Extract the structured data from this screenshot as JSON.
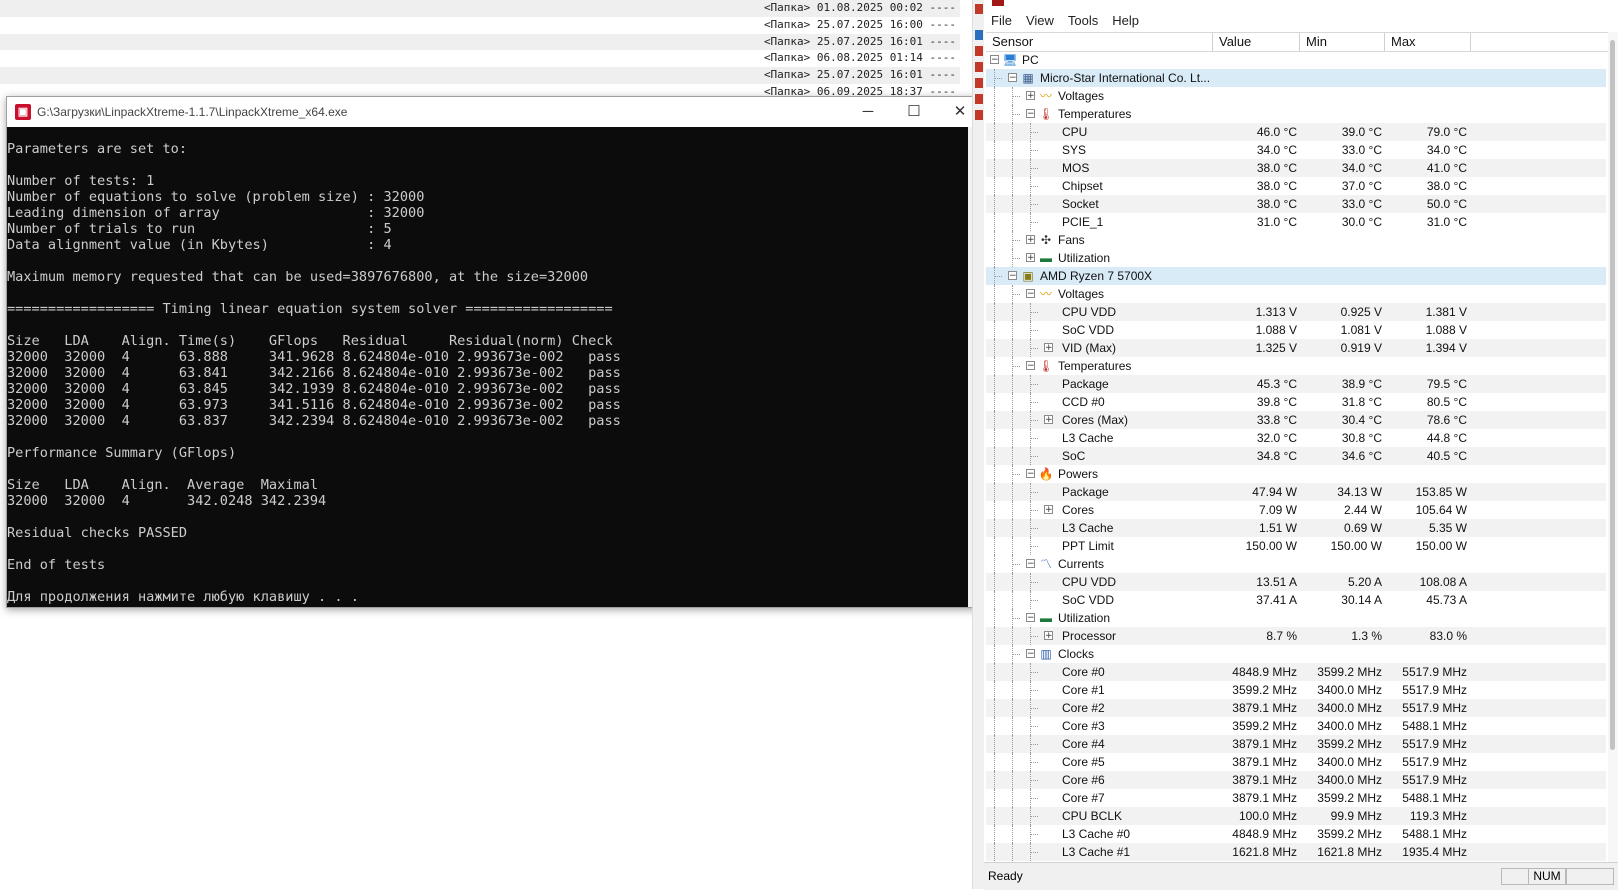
{
  "background_list": [
    {
      "text": "<Папка> 01.08.2025 00:02 ----"
    },
    {
      "text": "<Папка> 25.07.2025 16:00 ----"
    },
    {
      "text": "<Папка> 25.07.2025 16:01 ----"
    },
    {
      "text": "<Папка> 06.08.2025 01:14 ----"
    },
    {
      "text": "<Папка> 25.07.2025 16:01 ----"
    },
    {
      "text": "<Папка> 06.09.2025 18:37 ----"
    }
  ],
  "console": {
    "title": "G:\\Загрузки\\LinpackXtreme-1.1.7\\LinpackXtreme_x64.exe",
    "lines": [
      "Parameters are set to:",
      "",
      "Number of tests: 1",
      "Number of equations to solve (problem size) : 32000",
      "Leading dimension of array                  : 32000",
      "Number of trials to run                     : 5",
      "Data alignment value (in Kbytes)            : 4",
      "",
      "Maximum memory requested that can be used=3897676800, at the size=32000",
      "",
      "================== Timing linear equation system solver ==================",
      "",
      "Size   LDA    Align. Time(s)    GFlops   Residual     Residual(norm) Check",
      "32000  32000  4      63.888     341.9628 8.624804e-010 2.993673e-002   pass",
      "32000  32000  4      63.841     342.2166 8.624804e-010 2.993673e-002   pass",
      "32000  32000  4      63.845     342.1939 8.624804e-010 2.993673e-002   pass",
      "32000  32000  4      63.973     341.5116 8.624804e-010 2.993673e-002   pass",
      "32000  32000  4      63.837     342.2394 8.624804e-010 2.993673e-002   pass",
      "",
      "Performance Summary (GFlops)",
      "",
      "Size   LDA    Align.  Average  Maximal",
      "32000  32000  4       342.0248 342.2394",
      "",
      "Residual checks PASSED",
      "",
      "End of tests",
      "",
      "Для продолжения нажмите любую клавишу . . ."
    ]
  },
  "hwmonitor": {
    "menu": [
      "File",
      "View",
      "Tools",
      "Help"
    ],
    "columns": [
      "Sensor",
      "Value",
      "Min",
      "Max"
    ],
    "rows": [
      {
        "depth": 0,
        "exp": "-",
        "icon": "pc-icon",
        "label": "PC",
        "value": "",
        "min": "",
        "max": ""
      },
      {
        "depth": 1,
        "exp": "-",
        "icon": "motherboard-icon",
        "label": "Micro-Star International Co. Lt...",
        "value": "",
        "min": "",
        "max": "",
        "hl": true
      },
      {
        "depth": 2,
        "exp": "+",
        "icon": "voltage-icon",
        "label": "Voltages",
        "value": "",
        "min": "",
        "max": ""
      },
      {
        "depth": 2,
        "exp": "-",
        "icon": "thermometer-icon",
        "label": "Temperatures",
        "value": "",
        "min": "",
        "max": ""
      },
      {
        "depth": 3,
        "exp": "",
        "icon": "",
        "label": "CPU",
        "value": "46.0 °C",
        "min": "39.0 °C",
        "max": "79.0 °C"
      },
      {
        "depth": 3,
        "exp": "",
        "icon": "",
        "label": "SYS",
        "value": "34.0 °C",
        "min": "33.0 °C",
        "max": "34.0 °C"
      },
      {
        "depth": 3,
        "exp": "",
        "icon": "",
        "label": "MOS",
        "value": "38.0 °C",
        "min": "34.0 °C",
        "max": "41.0 °C"
      },
      {
        "depth": 3,
        "exp": "",
        "icon": "",
        "label": "Chipset",
        "value": "38.0 °C",
        "min": "37.0 °C",
        "max": "38.0 °C"
      },
      {
        "depth": 3,
        "exp": "",
        "icon": "",
        "label": "Socket",
        "value": "38.0 °C",
        "min": "33.0 °C",
        "max": "50.0 °C"
      },
      {
        "depth": 3,
        "exp": "",
        "icon": "",
        "label": "PCIE_1",
        "value": "31.0 °C",
        "min": "30.0 °C",
        "max": "31.0 °C"
      },
      {
        "depth": 2,
        "exp": "+",
        "icon": "fan-icon",
        "label": "Fans",
        "value": "",
        "min": "",
        "max": ""
      },
      {
        "depth": 2,
        "exp": "+",
        "icon": "utilization-icon",
        "label": "Utilization",
        "value": "",
        "min": "",
        "max": ""
      },
      {
        "depth": 1,
        "exp": "-",
        "icon": "cpu-chip-icon",
        "label": "AMD Ryzen 7 5700X",
        "value": "",
        "min": "",
        "max": "",
        "hl": true
      },
      {
        "depth": 2,
        "exp": "-",
        "icon": "voltage-icon",
        "label": "Voltages",
        "value": "",
        "min": "",
        "max": ""
      },
      {
        "depth": 3,
        "exp": "",
        "icon": "",
        "label": "CPU VDD",
        "value": "1.313 V",
        "min": "0.925 V",
        "max": "1.381 V"
      },
      {
        "depth": 3,
        "exp": "",
        "icon": "",
        "label": "SoC VDD",
        "value": "1.088 V",
        "min": "1.081 V",
        "max": "1.088 V"
      },
      {
        "depth": 3,
        "exp": "+",
        "icon": "",
        "label": "VID (Max)",
        "value": "1.325 V",
        "min": "0.919 V",
        "max": "1.394 V"
      },
      {
        "depth": 2,
        "exp": "-",
        "icon": "thermometer-icon",
        "label": "Temperatures",
        "value": "",
        "min": "",
        "max": ""
      },
      {
        "depth": 3,
        "exp": "",
        "icon": "",
        "label": "Package",
        "value": "45.3 °C",
        "min": "38.9 °C",
        "max": "79.5 °C"
      },
      {
        "depth": 3,
        "exp": "",
        "icon": "",
        "label": "CCD #0",
        "value": "39.8 °C",
        "min": "31.8 °C",
        "max": "80.5 °C"
      },
      {
        "depth": 3,
        "exp": "+",
        "icon": "",
        "label": "Cores (Max)",
        "value": "33.8 °C",
        "min": "30.4 °C",
        "max": "78.6 °C"
      },
      {
        "depth": 3,
        "exp": "",
        "icon": "",
        "label": "L3 Cache",
        "value": "32.0 °C",
        "min": "30.8 °C",
        "max": "44.8 °C"
      },
      {
        "depth": 3,
        "exp": "",
        "icon": "",
        "label": "SoC",
        "value": "34.8 °C",
        "min": "34.6 °C",
        "max": "40.5 °C"
      },
      {
        "depth": 2,
        "exp": "-",
        "icon": "power-icon",
        "label": "Powers",
        "value": "",
        "min": "",
        "max": ""
      },
      {
        "depth": 3,
        "exp": "",
        "icon": "",
        "label": "Package",
        "value": "47.94 W",
        "min": "34.13 W",
        "max": "153.85 W"
      },
      {
        "depth": 3,
        "exp": "+",
        "icon": "",
        "label": "Cores",
        "value": "7.09 W",
        "min": "2.44 W",
        "max": "105.64 W"
      },
      {
        "depth": 3,
        "exp": "",
        "icon": "",
        "label": "L3 Cache",
        "value": "1.51 W",
        "min": "0.69 W",
        "max": "5.35 W"
      },
      {
        "depth": 3,
        "exp": "",
        "icon": "",
        "label": "PPT Limit",
        "value": "150.00 W",
        "min": "150.00 W",
        "max": "150.00 W"
      },
      {
        "depth": 2,
        "exp": "-",
        "icon": "current-icon",
        "label": "Currents",
        "value": "",
        "min": "",
        "max": ""
      },
      {
        "depth": 3,
        "exp": "",
        "icon": "",
        "label": "CPU VDD",
        "value": "13.51 A",
        "min": "5.20 A",
        "max": "108.08 A"
      },
      {
        "depth": 3,
        "exp": "",
        "icon": "",
        "label": "SoC VDD",
        "value": "37.41 A",
        "min": "30.14 A",
        "max": "45.73 A"
      },
      {
        "depth": 2,
        "exp": "-",
        "icon": "utilization-icon",
        "label": "Utilization",
        "value": "",
        "min": "",
        "max": ""
      },
      {
        "depth": 3,
        "exp": "+",
        "icon": "",
        "label": "Processor",
        "value": "8.7 %",
        "min": "1.3 %",
        "max": "83.0 %"
      },
      {
        "depth": 2,
        "exp": "-",
        "icon": "clock-icon",
        "label": "Clocks",
        "value": "",
        "min": "",
        "max": ""
      },
      {
        "depth": 3,
        "exp": "",
        "icon": "",
        "label": "Core #0",
        "value": "4848.9 MHz",
        "min": "3599.2 MHz",
        "max": "5517.9 MHz"
      },
      {
        "depth": 3,
        "exp": "",
        "icon": "",
        "label": "Core #1",
        "value": "3599.2 MHz",
        "min": "3400.0 MHz",
        "max": "5517.9 MHz"
      },
      {
        "depth": 3,
        "exp": "",
        "icon": "",
        "label": "Core #2",
        "value": "3879.1 MHz",
        "min": "3400.0 MHz",
        "max": "5517.9 MHz"
      },
      {
        "depth": 3,
        "exp": "",
        "icon": "",
        "label": "Core #3",
        "value": "3599.2 MHz",
        "min": "3400.0 MHz",
        "max": "5488.1 MHz"
      },
      {
        "depth": 3,
        "exp": "",
        "icon": "",
        "label": "Core #4",
        "value": "3879.1 MHz",
        "min": "3599.2 MHz",
        "max": "5517.9 MHz"
      },
      {
        "depth": 3,
        "exp": "",
        "icon": "",
        "label": "Core #5",
        "value": "3879.1 MHz",
        "min": "3400.0 MHz",
        "max": "5517.9 MHz"
      },
      {
        "depth": 3,
        "exp": "",
        "icon": "",
        "label": "Core #6",
        "value": "3879.1 MHz",
        "min": "3400.0 MHz",
        "max": "5517.9 MHz"
      },
      {
        "depth": 3,
        "exp": "",
        "icon": "",
        "label": "Core #7",
        "value": "3879.1 MHz",
        "min": "3599.2 MHz",
        "max": "5488.1 MHz"
      },
      {
        "depth": 3,
        "exp": "",
        "icon": "",
        "label": "CPU BCLK",
        "value": "100.0 MHz",
        "min": "99.9 MHz",
        "max": "119.3 MHz"
      },
      {
        "depth": 3,
        "exp": "",
        "icon": "",
        "label": "L3 Cache #0",
        "value": "4848.9 MHz",
        "min": "3599.2 MHz",
        "max": "5488.1 MHz"
      },
      {
        "depth": 3,
        "exp": "",
        "icon": "",
        "label": "L3 Cache #1",
        "value": "1621.8 MHz",
        "min": "1621.8 MHz",
        "max": "1935.4 MHz"
      }
    ],
    "status": {
      "text": "Ready",
      "num": "NUM"
    }
  }
}
